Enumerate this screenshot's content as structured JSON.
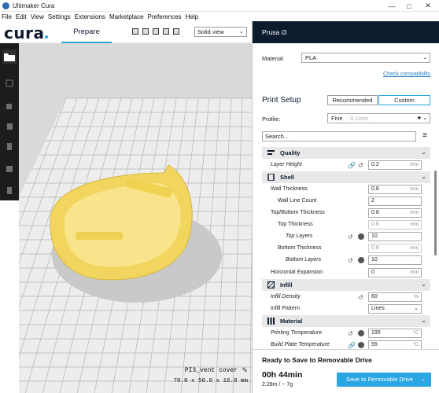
{
  "window": {
    "title": "Ultimaker Cura"
  },
  "menu": [
    "File",
    "Edit",
    "View",
    "Settings",
    "Extensions",
    "Marketplace",
    "Preferences",
    "Help"
  ],
  "header": {
    "logo": "cura",
    "tab_prepare": "Prepare",
    "view_mode": "Solid view"
  },
  "model": {
    "name": "PI3_vent cover",
    "dimensions": "70.0 x 50.0 x 16.0 mm"
  },
  "panel": {
    "printer": "Prusa i3",
    "material_label": "Material",
    "material_value": "PLA",
    "compat_link": "Check compatibility",
    "print_setup": "Print Setup",
    "mode_recommended": "Recommended",
    "mode_custom": "Custom",
    "profile_label": "Profile:",
    "profile_value": "Fine",
    "profile_hint": "- 0.1mm",
    "search_placeholder": "Search..."
  },
  "settings": {
    "quality": "Quality",
    "layer_height": "Layer Height",
    "layer_height_v": "0.2",
    "mm": "mm",
    "shell": "Shell",
    "wall_thickness": "Wall Thickness",
    "wall_thickness_v": "0.8",
    "wall_line_count": "Wall Line Count",
    "wall_line_count_v": "2",
    "topbottom": "Top/Bottom Thickness",
    "topbottom_v": "0.8",
    "top_thickness": "Top Thickness",
    "top_thickness_v": "0.8",
    "top_layers": "Top Layers",
    "top_layers_v": "10",
    "bottom_thickness": "Bottom Thickness",
    "bottom_thickness_v": "0.8",
    "bottom_layers": "Bottom Layers",
    "bottom_layers_v": "10",
    "horizontal_expansion": "Horizontal Expansion",
    "horizontal_expansion_v": "0",
    "infill": "Infill",
    "infill_density": "Infill Density",
    "infill_density_v": "60",
    "percent": "%",
    "infill_pattern": "Infill Pattern",
    "infill_pattern_v": "Lines",
    "material": "Material",
    "printing_temp": "Printing Temperature",
    "printing_temp_v": "195",
    "degc": "°C",
    "build_plate_temp": "Build Plate Temperature",
    "build_plate_temp_v": "55"
  },
  "bottom": {
    "status": "Ready to Save to Removable Drive",
    "time": "00h 44min",
    "material_use": "2.28m / ~ 7g",
    "save_button": "Save to Removable Drive"
  },
  "colors": {
    "accent": "#2aa7e3",
    "header_dark": "#0d1b2e",
    "model_yellow": "#f7dd6e"
  }
}
